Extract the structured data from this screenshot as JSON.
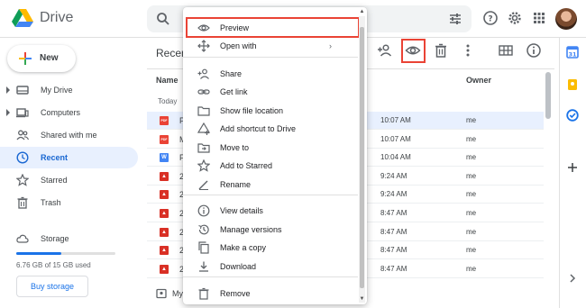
{
  "app": {
    "title": "Drive"
  },
  "search": {
    "placeholder": ""
  },
  "sidebar": {
    "new_label": "New",
    "items": [
      {
        "label": "My Drive",
        "icon": "my-drive-icon",
        "has_caret": true
      },
      {
        "label": "Computers",
        "icon": "computers-icon",
        "has_caret": true
      },
      {
        "label": "Shared with me",
        "icon": "shared-icon",
        "has_caret": false
      },
      {
        "label": "Recent",
        "icon": "clock-icon",
        "has_caret": false,
        "active": true
      },
      {
        "label": "Starred",
        "icon": "star-icon",
        "has_caret": false
      },
      {
        "label": "Trash",
        "icon": "trash-icon",
        "has_caret": false
      }
    ],
    "storage_label": "Storage",
    "storage_usage": "6.76 GB of 15 GB used",
    "storage_fraction": 0.45,
    "buy_storage_label": "Buy storage"
  },
  "main": {
    "title": "Recent",
    "columns": {
      "name": "Name",
      "owner": "Owner"
    },
    "section_label": "Today",
    "rows": [
      {
        "icon": "pdf",
        "name": "P",
        "time": "10:07 AM",
        "owner": "me",
        "selected": true
      },
      {
        "icon": "pdf",
        "name": "M",
        "time": "10:07 AM",
        "owner": "me"
      },
      {
        "icon": "word",
        "name": "F",
        "time": "10:04 AM",
        "owner": "me"
      },
      {
        "icon": "image",
        "name": "2",
        "time": "9:24 AM",
        "owner": "me"
      },
      {
        "icon": "image",
        "name": "2",
        "time": "9:24 AM",
        "owner": "me"
      },
      {
        "icon": "image",
        "name": "2",
        "time": "8:47 AM",
        "owner": "me"
      },
      {
        "icon": "image",
        "name": "2",
        "time": "8:47 AM",
        "owner": "me"
      },
      {
        "icon": "image",
        "name": "2",
        "time": "8:47 AM",
        "owner": "me"
      },
      {
        "icon": "image",
        "name": "2",
        "time": "8:47 AM",
        "owner": "me"
      }
    ],
    "folder_row_name": "My"
  },
  "context_menu": {
    "items": [
      {
        "label": "Preview",
        "icon": "eye-icon",
        "highlighted": true
      },
      {
        "label": "Open with",
        "icon": "move-cross-icon",
        "submenu": true
      },
      {
        "label": "Share",
        "icon": "person-add-icon"
      },
      {
        "label": "Get link",
        "icon": "link-icon"
      },
      {
        "label": "Show file location",
        "icon": "folder-icon"
      },
      {
        "label": "Add shortcut to Drive",
        "icon": "add-shortcut-icon"
      },
      {
        "label": "Move to",
        "icon": "move-to-icon"
      },
      {
        "label": "Add to Starred",
        "icon": "star-outline-icon"
      },
      {
        "label": "Rename",
        "icon": "pencil-icon"
      },
      {
        "label": "View details",
        "icon": "info-icon"
      },
      {
        "label": "Manage versions",
        "icon": "history-icon"
      },
      {
        "label": "Make a copy",
        "icon": "copy-icon"
      },
      {
        "label": "Download",
        "icon": "download-icon"
      },
      {
        "label": "Remove",
        "icon": "trash-icon"
      }
    ],
    "submenu_arrow": "›"
  },
  "colors": {
    "accent": "#1a73e8",
    "highlight_box": "#ea4335",
    "selected_row": "#e8f0fe",
    "pdf": "#ea4335",
    "word": "#4285f4",
    "image": "#d93025"
  }
}
